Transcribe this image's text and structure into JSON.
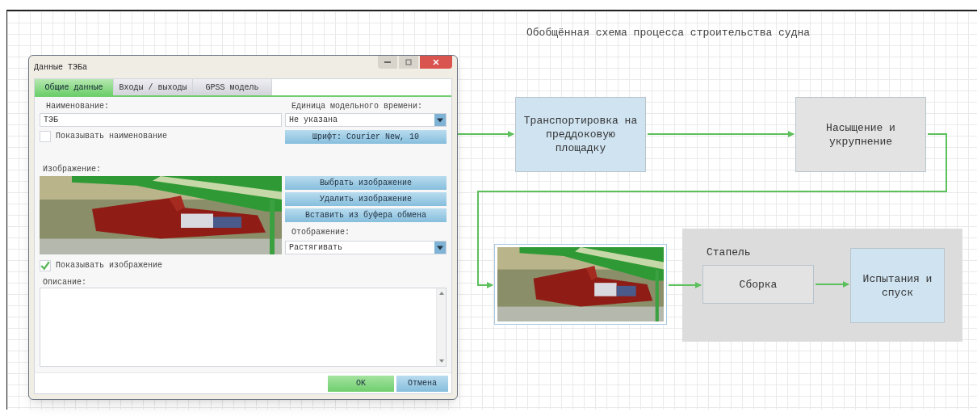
{
  "diagram": {
    "title": "Обобщённая схема процесса строительства судна",
    "nodes": [
      {
        "kind": "process",
        "label": "Транспортировка на преддоковую площадку",
        "color": "#cfe3f1"
      },
      {
        "kind": "process",
        "label": "Насыщение и укрупнение",
        "color": "#e3e3e3"
      },
      {
        "kind": "picture"
      },
      {
        "kind": "group",
        "label": "Стапель"
      },
      {
        "kind": "process",
        "label": "Сборка",
        "color": "#e3e3e3"
      },
      {
        "kind": "process",
        "label": "Испытания и спуск",
        "color": "#cfe3f1"
      }
    ]
  },
  "dialog": {
    "title": "Данные ТЭБа",
    "tabs": [
      {
        "label": "Общие данные",
        "selected": true
      },
      {
        "label": "Входы / выходы",
        "selected": false
      },
      {
        "label": "GPSS модель",
        "selected": false
      }
    ],
    "name_label": "Наименование:",
    "name_value": "ТЭБ",
    "time_unit_label": "Единица модельного времени:",
    "time_unit_value": "Не указана",
    "show_name": {
      "label": "Показывать наименование",
      "checked": false
    },
    "font_button": "Шрифт: Courier New, 10",
    "image_label": "Изображение:",
    "image_buttons": [
      "Выбрать изображение",
      "Удалить изображение",
      "Вставить из буфера обмена"
    ],
    "display_label": "Отображение:",
    "display_value": "Растягивать",
    "show_image": {
      "label": "Показывать изображение",
      "checked": true
    },
    "description_label": "Описание:",
    "ok": "OK",
    "cancel": "Отмена"
  }
}
